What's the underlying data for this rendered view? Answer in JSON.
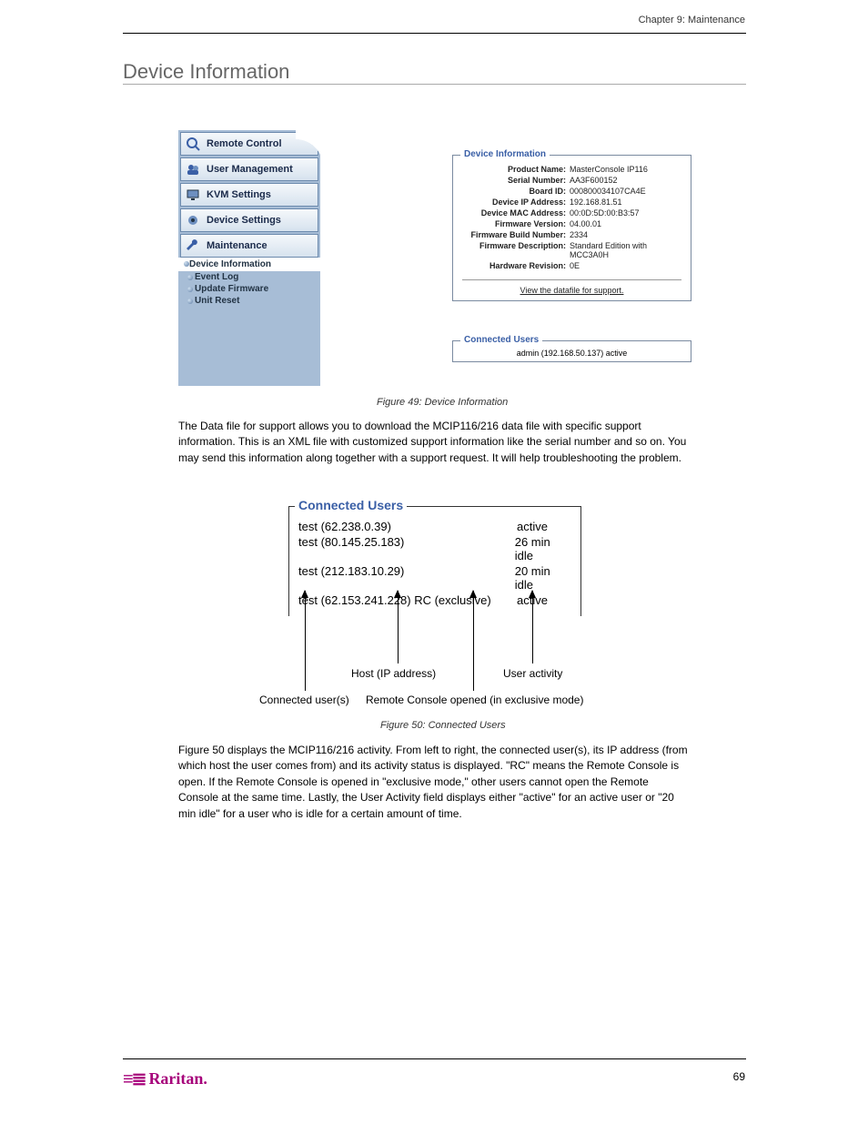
{
  "header": {
    "chapter": "Chapter 9: Maintenance",
    "title": "Device Information"
  },
  "sidebar": {
    "items": [
      {
        "label": "Remote Control"
      },
      {
        "label": "User Management"
      },
      {
        "label": "KVM Settings"
      },
      {
        "label": "Device Settings"
      },
      {
        "label": "Maintenance"
      }
    ],
    "active": "Device Information",
    "subs": [
      "Event Log",
      "Update Firmware",
      "Unit Reset"
    ]
  },
  "device_info": {
    "legend": "Device Information",
    "rows": [
      {
        "label": "Product Name:",
        "value": "MasterConsole IP116"
      },
      {
        "label": "Serial Number:",
        "value": "AA3F600152"
      },
      {
        "label": "Board ID:",
        "value": "000800034107CA4E"
      },
      {
        "label": "Device IP Address:",
        "value": "192.168.81.51"
      },
      {
        "label": "Device MAC Address:",
        "value": "00:0D:5D:00:B3:57"
      },
      {
        "label": "Firmware Version:",
        "value": "04.00.01"
      },
      {
        "label": "Firmware Build Number:",
        "value": "2334"
      },
      {
        "label": "Firmware Description:",
        "value": "Standard Edition with MCC3A0H"
      },
      {
        "label": "Hardware Revision:",
        "value": "0E"
      }
    ],
    "link": "View the datafile for support."
  },
  "connected_small": {
    "legend": "Connected Users",
    "entry": "admin (192.168.50.137)   active"
  },
  "fig1": "Figure 49: Device Information",
  "body_text": "The Data file for support allows you to download the MCIP116/216 data file with specific support information. This is an XML file with customized support information like the serial number and so on. You may send this information along together with a support request. It will help troubleshooting the problem.",
  "connected_big": {
    "legend": "Connected Users",
    "rows": [
      {
        "left": "test (62.238.0.39)",
        "right": "active"
      },
      {
        "left": "test (80.145.25.183)",
        "right": "26 min idle"
      },
      {
        "left": "test (212.183.10.29)",
        "right": "20 min idle"
      },
      {
        "left": "test (62.153.241.228) RC (exclusive)",
        "right": "active"
      }
    ]
  },
  "annotations": {
    "host": "Host (IP address)",
    "activity": "User activity",
    "connected": "Connected user(s)",
    "rc": "Remote Console opened (in exclusive mode)"
  },
  "fig2": "Figure 50: Connected Users",
  "body_text2": "Figure 50 displays the MCIP116/216 activity. From left to right, the connected user(s), its IP address (from which host the user comes from) and its activity status is displayed. \"RC\" means the Remote Console is open. If the Remote Console is opened in \"exclusive mode,\" other users cannot open the Remote Console at the same time. Lastly, the User Activity field displays either \"active\" for an active user or \"20 min idle\" for a user who is idle for a certain amount of time.",
  "footer": {
    "logo": "Raritan.",
    "page": "69"
  }
}
